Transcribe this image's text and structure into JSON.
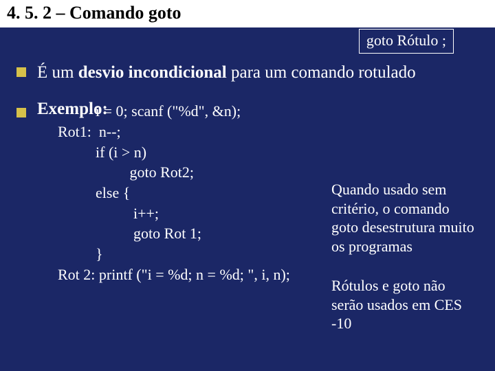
{
  "title": "4. 5. 2 – Comando goto",
  "syntax": "goto  Rótulo  ;",
  "bullet1_a": "É um ",
  "bullet1_b": "desvio incondicional",
  "bullet1_c": " para um comando rotulado",
  "exemplo_label": "Exemplo:",
  "code": "          i = 0; scanf (\"%d\", &n);\nRot1:  n--;\n          if (i > n)\n                   goto Rot2;\n          else {\n                    i++;\n                    goto Rot 1;\n          }\nRot 2: printf (\"i = %d; n = %d; \", i, n);",
  "note1": "Quando usado sem critério, o comando goto desestrutura muito os programas",
  "note2": "Rótulos e goto não serão usados em CES -10"
}
